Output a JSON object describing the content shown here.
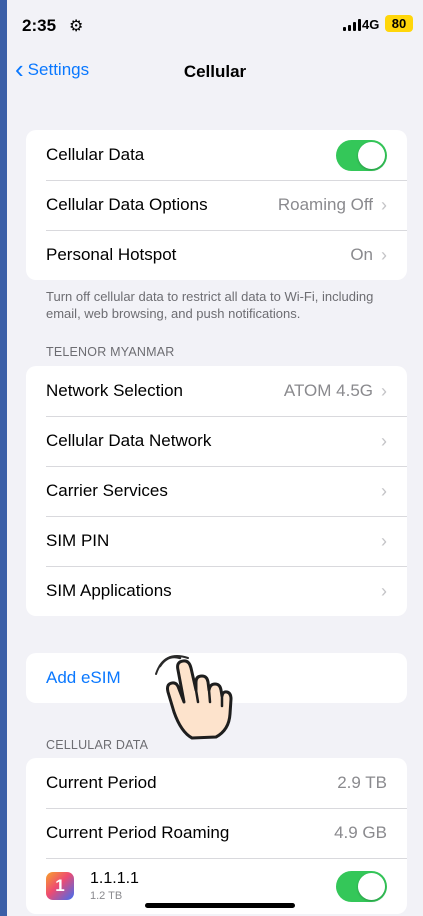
{
  "status_bar": {
    "time": "2:35",
    "network": "4G",
    "battery": "80"
  },
  "nav": {
    "back_label": "Settings",
    "title": "Cellular"
  },
  "group1": {
    "cellular_data_label": "Cellular Data",
    "cellular_data_options_label": "Cellular Data Options",
    "cellular_data_options_value": "Roaming Off",
    "personal_hotspot_label": "Personal Hotspot",
    "personal_hotspot_value": "On"
  },
  "footnote": "Turn off cellular data to restrict all data to Wi-Fi, including email, web browsing, and push notifications.",
  "carrier_header": "TELENOR MYANMAR",
  "carrier": {
    "network_selection_label": "Network Selection",
    "network_selection_value": "ATOM 4.5G",
    "cellular_data_network_label": "Cellular Data Network",
    "carrier_services_label": "Carrier Services",
    "sim_pin_label": "SIM PIN",
    "sim_applications_label": "SIM Applications"
  },
  "add_esim_label": "Add eSIM",
  "cellular_data_header": "CELLULAR DATA",
  "usage": {
    "current_period_label": "Current Period",
    "current_period_value": "2.9 TB",
    "current_period_roaming_label": "Current Period Roaming",
    "current_period_roaming_value": "4.9 GB"
  },
  "app": {
    "icon_text": "1",
    "name": "1.1.1.1",
    "usage": "1.2 TB"
  },
  "colors": {
    "accent": "#0a78ff",
    "toggle_on": "#34c759",
    "battery": "#ffd60a"
  }
}
